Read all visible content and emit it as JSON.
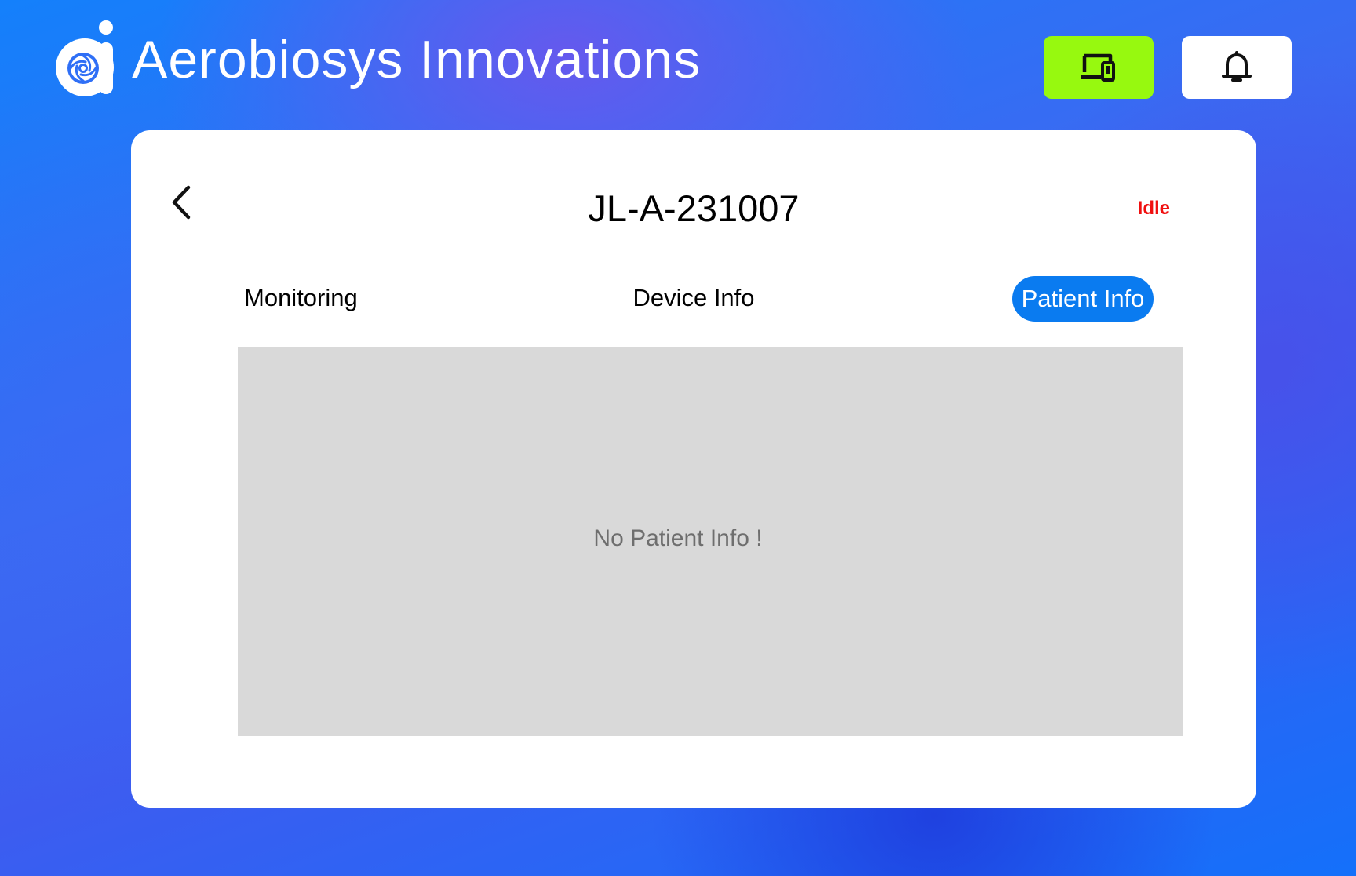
{
  "app": {
    "brand_name": "Aerobiosys Innovations",
    "logo_icon": "aerobiosys-logo-icon"
  },
  "header": {
    "devices_button": {
      "icon": "devices-icon",
      "color": "#97f90f"
    },
    "notifications_button": {
      "icon": "bell-icon",
      "color": "#ffffff"
    }
  },
  "device": {
    "id": "JL-A-231007",
    "status": "Idle",
    "status_color": "#f00f0f",
    "back_icon": "chevron-left-icon"
  },
  "tabs": [
    {
      "label": "Monitoring",
      "active": false
    },
    {
      "label": "Device Info",
      "active": false
    },
    {
      "label": "Patient Info",
      "active": true
    }
  ],
  "colors": {
    "accent": "#0a7bf0",
    "panel_bg": "#d9d9d9"
  },
  "patient_info": {
    "empty_message": "No Patient Info !"
  }
}
